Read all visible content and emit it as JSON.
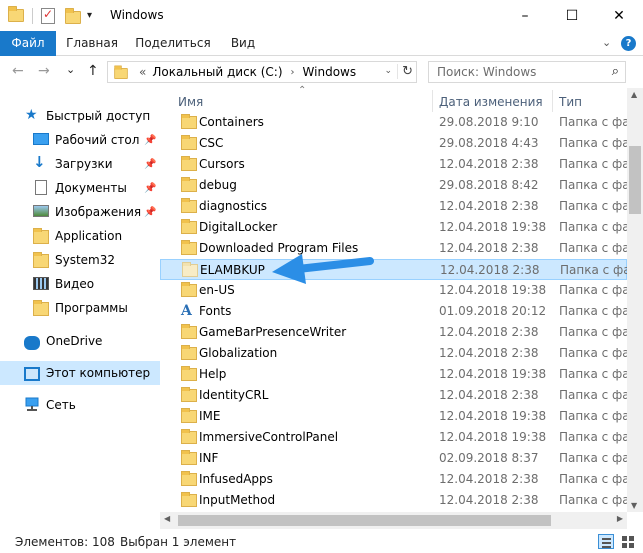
{
  "window": {
    "title": "Windows",
    "qa_dropdown_icon": "chevron-down-icon"
  },
  "window_controls": {
    "minimize": "–",
    "maximize": "☐",
    "close": "✕"
  },
  "ribbon": {
    "tabs": [
      {
        "label": "Файл",
        "active": true
      },
      {
        "label": "Главная",
        "active": false
      },
      {
        "label": "Поделиться",
        "active": false
      },
      {
        "label": "Вид",
        "active": false
      }
    ],
    "collapse_icon": "chevron-down-icon",
    "help_label": "?"
  },
  "navigation": {
    "back": "←",
    "forward": "→",
    "recent": "⌄",
    "up": "↑",
    "address": {
      "overflow": "«",
      "crumbs": [
        "Локальный диск (C:)",
        "Windows"
      ],
      "separator": "›",
      "refresh": "↻",
      "dropdown": "⌄"
    },
    "search": {
      "placeholder": "Поиск: Windows",
      "icon": "search-icon"
    }
  },
  "sidebar": {
    "items": [
      {
        "label": "Быстрый доступ",
        "icon": "star-icon",
        "pinned": false,
        "selected": false
      },
      {
        "label": "Рабочий стол",
        "icon": "desktop-icon",
        "pinned": true,
        "selected": false
      },
      {
        "label": "Загрузки",
        "icon": "download-icon",
        "pinned": true,
        "selected": false
      },
      {
        "label": "Документы",
        "icon": "documents-icon",
        "pinned": true,
        "selected": false
      },
      {
        "label": "Изображения",
        "icon": "pictures-icon",
        "pinned": true,
        "selected": false
      },
      {
        "label": "Application",
        "icon": "folder-icon",
        "pinned": false,
        "selected": false
      },
      {
        "label": "System32",
        "icon": "folder-icon",
        "pinned": false,
        "selected": false
      },
      {
        "label": "Видео",
        "icon": "video-icon",
        "pinned": false,
        "selected": false
      },
      {
        "label": "Программы",
        "icon": "folder-icon",
        "pinned": false,
        "selected": false
      },
      {
        "label": "OneDrive",
        "icon": "cloud-icon",
        "pinned": false,
        "selected": false
      },
      {
        "label": "Этот компьютер",
        "icon": "computer-icon",
        "pinned": false,
        "selected": true
      },
      {
        "label": "Сеть",
        "icon": "network-icon",
        "pinned": false,
        "selected": false
      }
    ],
    "pin_glyph": "📌"
  },
  "file_list": {
    "columns": [
      "Имя",
      "Дата изменения",
      "Тип"
    ],
    "sort_indicator": "⌃",
    "rows": [
      {
        "name": "Containers",
        "date": "29.08.2018 9:10",
        "type": "Папка с фай",
        "icon": "folder-icon",
        "selected": false
      },
      {
        "name": "CSC",
        "date": "29.08.2018 4:43",
        "type": "Папка с фай",
        "icon": "folder-icon",
        "selected": false
      },
      {
        "name": "Cursors",
        "date": "12.04.2018 2:38",
        "type": "Папка с фай",
        "icon": "folder-icon",
        "selected": false
      },
      {
        "name": "debug",
        "date": "29.08.2018 8:42",
        "type": "Папка с фай",
        "icon": "folder-icon",
        "selected": false
      },
      {
        "name": "diagnostics",
        "date": "12.04.2018 2:38",
        "type": "Папка с фай",
        "icon": "folder-icon",
        "selected": false
      },
      {
        "name": "DigitalLocker",
        "date": "12.04.2018 19:38",
        "type": "Папка с фай",
        "icon": "folder-icon",
        "selected": false
      },
      {
        "name": "Downloaded Program Files",
        "date": "12.04.2018 2:38",
        "type": "Папка с фай",
        "icon": "folder-icon",
        "selected": false
      },
      {
        "name": "ELAMBKUP",
        "date": "12.04.2018 2:38",
        "type": "Папка с фай",
        "icon": "folder-icon",
        "selected": true
      },
      {
        "name": "en-US",
        "date": "12.04.2018 19:38",
        "type": "Папка с фай",
        "icon": "folder-icon",
        "selected": false
      },
      {
        "name": "Fonts",
        "date": "01.09.2018 20:12",
        "type": "Папка с фай",
        "icon": "fonts-folder-icon",
        "selected": false
      },
      {
        "name": "GameBarPresenceWriter",
        "date": "12.04.2018 2:38",
        "type": "Папка с фай",
        "icon": "folder-icon",
        "selected": false
      },
      {
        "name": "Globalization",
        "date": "12.04.2018 2:38",
        "type": "Папка с фай",
        "icon": "folder-icon",
        "selected": false
      },
      {
        "name": "Help",
        "date": "12.04.2018 19:38",
        "type": "Папка с фай",
        "icon": "folder-icon",
        "selected": false
      },
      {
        "name": "IdentityCRL",
        "date": "12.04.2018 2:38",
        "type": "Папка с фай",
        "icon": "folder-icon",
        "selected": false
      },
      {
        "name": "IME",
        "date": "12.04.2018 19:38",
        "type": "Папка с фай",
        "icon": "folder-icon",
        "selected": false
      },
      {
        "name": "ImmersiveControlPanel",
        "date": "12.04.2018 19:38",
        "type": "Папка с фай",
        "icon": "folder-icon",
        "selected": false
      },
      {
        "name": "INF",
        "date": "02.09.2018 8:37",
        "type": "Папка с фай",
        "icon": "folder-icon",
        "selected": false
      },
      {
        "name": "InfusedApps",
        "date": "12.04.2018 2:38",
        "type": "Папка с фай",
        "icon": "folder-icon",
        "selected": false
      },
      {
        "name": "InputMethod",
        "date": "12.04.2018 2:38",
        "type": "Папка с фай",
        "icon": "folder-icon",
        "selected": false
      }
    ]
  },
  "status_bar": {
    "items_count": "Элементов: 108",
    "selected": "Выбран 1 элемент"
  },
  "colors": {
    "accent": "#1979ca",
    "selection": "#cce8ff",
    "annotation_arrow": "#2b8ee6"
  }
}
